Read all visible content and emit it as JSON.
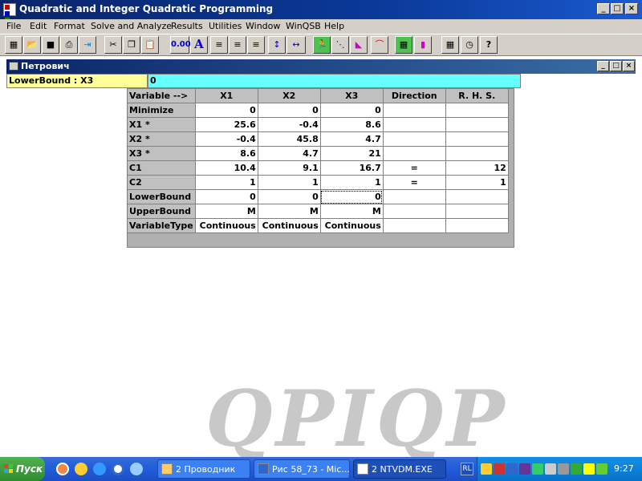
{
  "app": {
    "title": "Quadratic and Integer Quadratic Programming",
    "controls": {
      "minimize": "_",
      "maximize": "□",
      "close": "×"
    }
  },
  "menu": [
    "File",
    "Edit",
    "Format",
    "Solve and Analyze",
    "Results",
    "Utilities",
    "Window",
    "WinQSB",
    "Help"
  ],
  "toolbar": {
    "zero_format_label": "0.00",
    "font_label": "A",
    "help_label": "?",
    "icons": [
      "new-grid-icon",
      "open-folder-icon",
      "save-disk-icon",
      "print-icon",
      "exit-icon",
      "cut-icon",
      "copy-icon",
      "paste-icon",
      "number-format-icon",
      "font-icon",
      "align-left-icon",
      "align-center-icon",
      "align-right-icon",
      "row-height-icon",
      "column-width-icon",
      "solve-icon",
      "graph-icon",
      "model-icon",
      "curve-icon",
      "grid-view-icon",
      "bar-chart-icon",
      "calculator-icon",
      "clock-icon",
      "help-icon"
    ]
  },
  "child_window": {
    "title": "Петрович"
  },
  "cell_reference": "LowerBound : X3",
  "cell_value": "0",
  "grid": {
    "corner": "Variable -->",
    "columns": [
      "X1",
      "X2",
      "X3",
      "Direction",
      "R. H. S."
    ],
    "rows": [
      {
        "label": "Minimize",
        "cells": [
          "0",
          "0",
          "0",
          "",
          ""
        ]
      },
      {
        "label": "X1 *",
        "cells": [
          "25.6",
          "-0.4",
          "8.6",
          "",
          ""
        ]
      },
      {
        "label": "X2 *",
        "cells": [
          "-0.4",
          "45.8",
          "4.7",
          "",
          ""
        ]
      },
      {
        "label": "X3 *",
        "cells": [
          "8.6",
          "4.7",
          "21",
          "",
          ""
        ]
      },
      {
        "label": "C1",
        "cells": [
          "10.4",
          "9.1",
          "16.7",
          "=",
          "12"
        ]
      },
      {
        "label": "C2",
        "cells": [
          "1",
          "1",
          "1",
          "=",
          "1"
        ]
      },
      {
        "label": "LowerBound",
        "cells": [
          "0",
          "0",
          "0",
          "",
          ""
        ]
      },
      {
        "label": "UpperBound",
        "cells": [
          "M",
          "M",
          "M",
          "",
          ""
        ]
      },
      {
        "label": "VariableType",
        "cells": [
          "Continuous",
          "Continuous",
          "Continuous",
          "",
          ""
        ]
      }
    ]
  },
  "watermark": "QPIQP",
  "taskbar": {
    "start_label": "Пуск",
    "items": [
      {
        "label": "2 Проводник",
        "active": false
      },
      {
        "label": "Рис 58_73 - Mic...",
        "active": false
      },
      {
        "label": "2 NTVDM.EXE",
        "active": true
      }
    ],
    "language": "RL",
    "clock": "9:27"
  }
}
